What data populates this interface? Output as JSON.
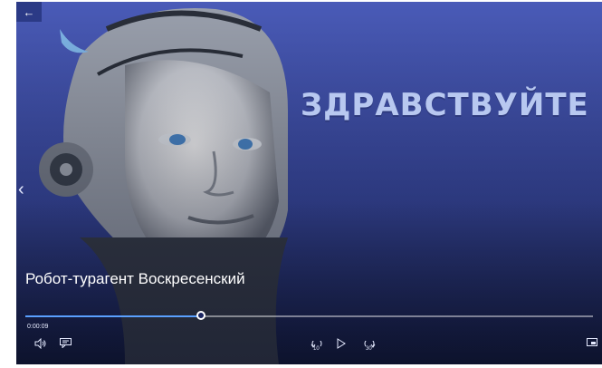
{
  "header": {
    "back_icon": "arrow-left-icon"
  },
  "video": {
    "headline": "ЗДРАВСТВУЙТЕ",
    "title": "Робот-турагент Воскресенский"
  },
  "playback": {
    "elapsed": "0:00:09",
    "progress": 0.31,
    "skip_back_seconds": "10",
    "skip_forward_seconds": "30"
  },
  "controls": {
    "volume_icon": "volume-icon",
    "captions_icon": "captions-icon",
    "skip_back_icon": "skip-back-icon",
    "play_icon": "play-icon",
    "skip_forward_icon": "skip-forward-icon",
    "miniview_icon": "miniview-icon",
    "prev_icon": "chevron-left-icon"
  },
  "colors": {
    "background": "#3d4fa8",
    "accent": "#5aa0ff"
  }
}
